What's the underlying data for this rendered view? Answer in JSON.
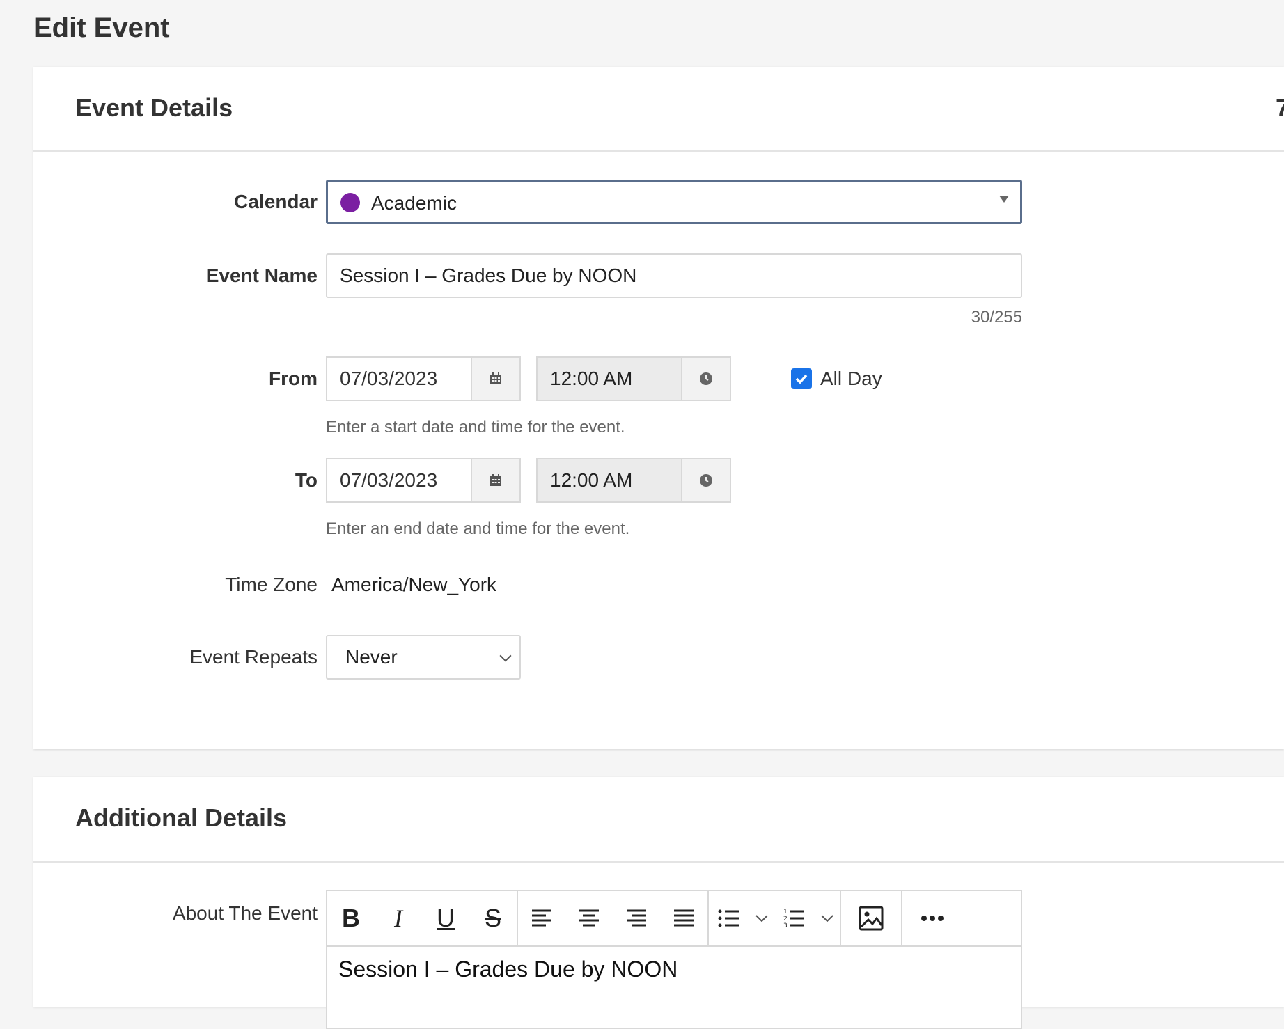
{
  "page": {
    "title": "Edit Event"
  },
  "event_details": {
    "title": "Event Details",
    "extra": "7",
    "calendar": {
      "label": "Calendar",
      "value": "Academic",
      "color": "#7b1fa2"
    },
    "event_name": {
      "label": "Event Name",
      "value": "Session I – Grades Due by NOON",
      "counter": "30/255"
    },
    "from": {
      "label": "From",
      "date": "07/03/2023",
      "time": "12:00 AM",
      "help": "Enter a start date and time for the event."
    },
    "all_day": {
      "label": "All Day",
      "checked": true
    },
    "to": {
      "label": "To",
      "date": "07/03/2023",
      "time": "12:00 AM",
      "help": "Enter an end date and time for the event."
    },
    "time_zone": {
      "label": "Time Zone",
      "value": "America/New_York"
    },
    "repeats": {
      "label": "Event Repeats",
      "value": "Never"
    }
  },
  "additional_details": {
    "title": "Additional Details",
    "about": {
      "label": "About The Event",
      "content": "Session I – Grades Due by NOON"
    }
  },
  "toolbar": {
    "icons": [
      "bold-icon",
      "italic-icon",
      "underline-icon",
      "strikethrough-icon",
      "align-left-icon",
      "align-center-icon",
      "align-right-icon",
      "align-justify-icon",
      "bullet-list-icon",
      "numbered-list-icon",
      "image-icon",
      "more-icon"
    ]
  },
  "colors": {
    "checkbox": "#1a73e8",
    "focus_border": "#5a6e8c"
  }
}
